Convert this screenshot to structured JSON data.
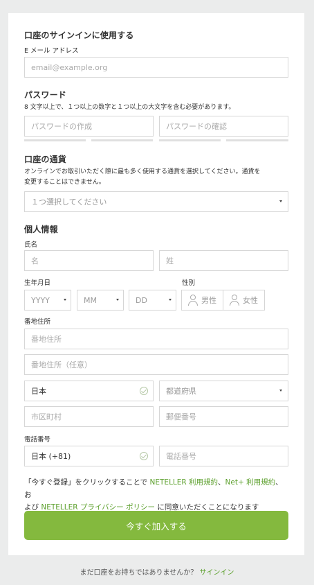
{
  "account": {
    "title": "口座のサインインに使用する",
    "email_label": "E メール アドレス",
    "email_placeholder": "email@example.org"
  },
  "password": {
    "title": "パスワード",
    "hint": "8 文字以上で、１つ以上の数字と１つ以上の大文字を含む必要があります。",
    "create_placeholder": "パスワードの作成",
    "confirm_placeholder": "パスワードの確認"
  },
  "currency": {
    "title": "口座の通貨",
    "hint_line1": "オンラインでお取引いただく際に最も多く使用する通貨を選択してください。通貨を",
    "hint_line2": "変更することはできません。",
    "select_value": "１つ選択してください"
  },
  "personal": {
    "title": "個人情報",
    "name_label": "氏名",
    "first_name_placeholder": "名",
    "last_name_placeholder": "姓",
    "dob_label": "生年月日",
    "year": "YYYY",
    "month": "MM",
    "day": "DD",
    "gender_label": "性別",
    "male": "男性",
    "female": "女性",
    "address_label": "番地住所",
    "address1_placeholder": "番地住所",
    "address2_placeholder": "番地住所（任意）",
    "country_value": "日本",
    "prefecture_value": "都道府県",
    "city_placeholder": "市区町村",
    "postal_placeholder": "郵便番号",
    "phone_label": "電話番号",
    "phone_country_value": "日本 (+81)",
    "phone_placeholder": "電話番号"
  },
  "terms": {
    "part1": "「今すぐ登録」をクリックすることで ",
    "link1": "NETELLER 利用規約",
    "sep1": "、",
    "link2": "Net+ 利用規約",
    "part2": "、お",
    "part3": "よび ",
    "link3": "NETELLER プライバシー ポリシー",
    "part4": " に同意いただくことになります"
  },
  "submit_label": "今すぐ加入する",
  "footer": {
    "text": "まだ口座をお持ちではありませんか？ ",
    "link": "サインイン"
  },
  "colors": {
    "accent": "#84b93e",
    "link": "#5b9f2b",
    "background": "#ebecec"
  }
}
